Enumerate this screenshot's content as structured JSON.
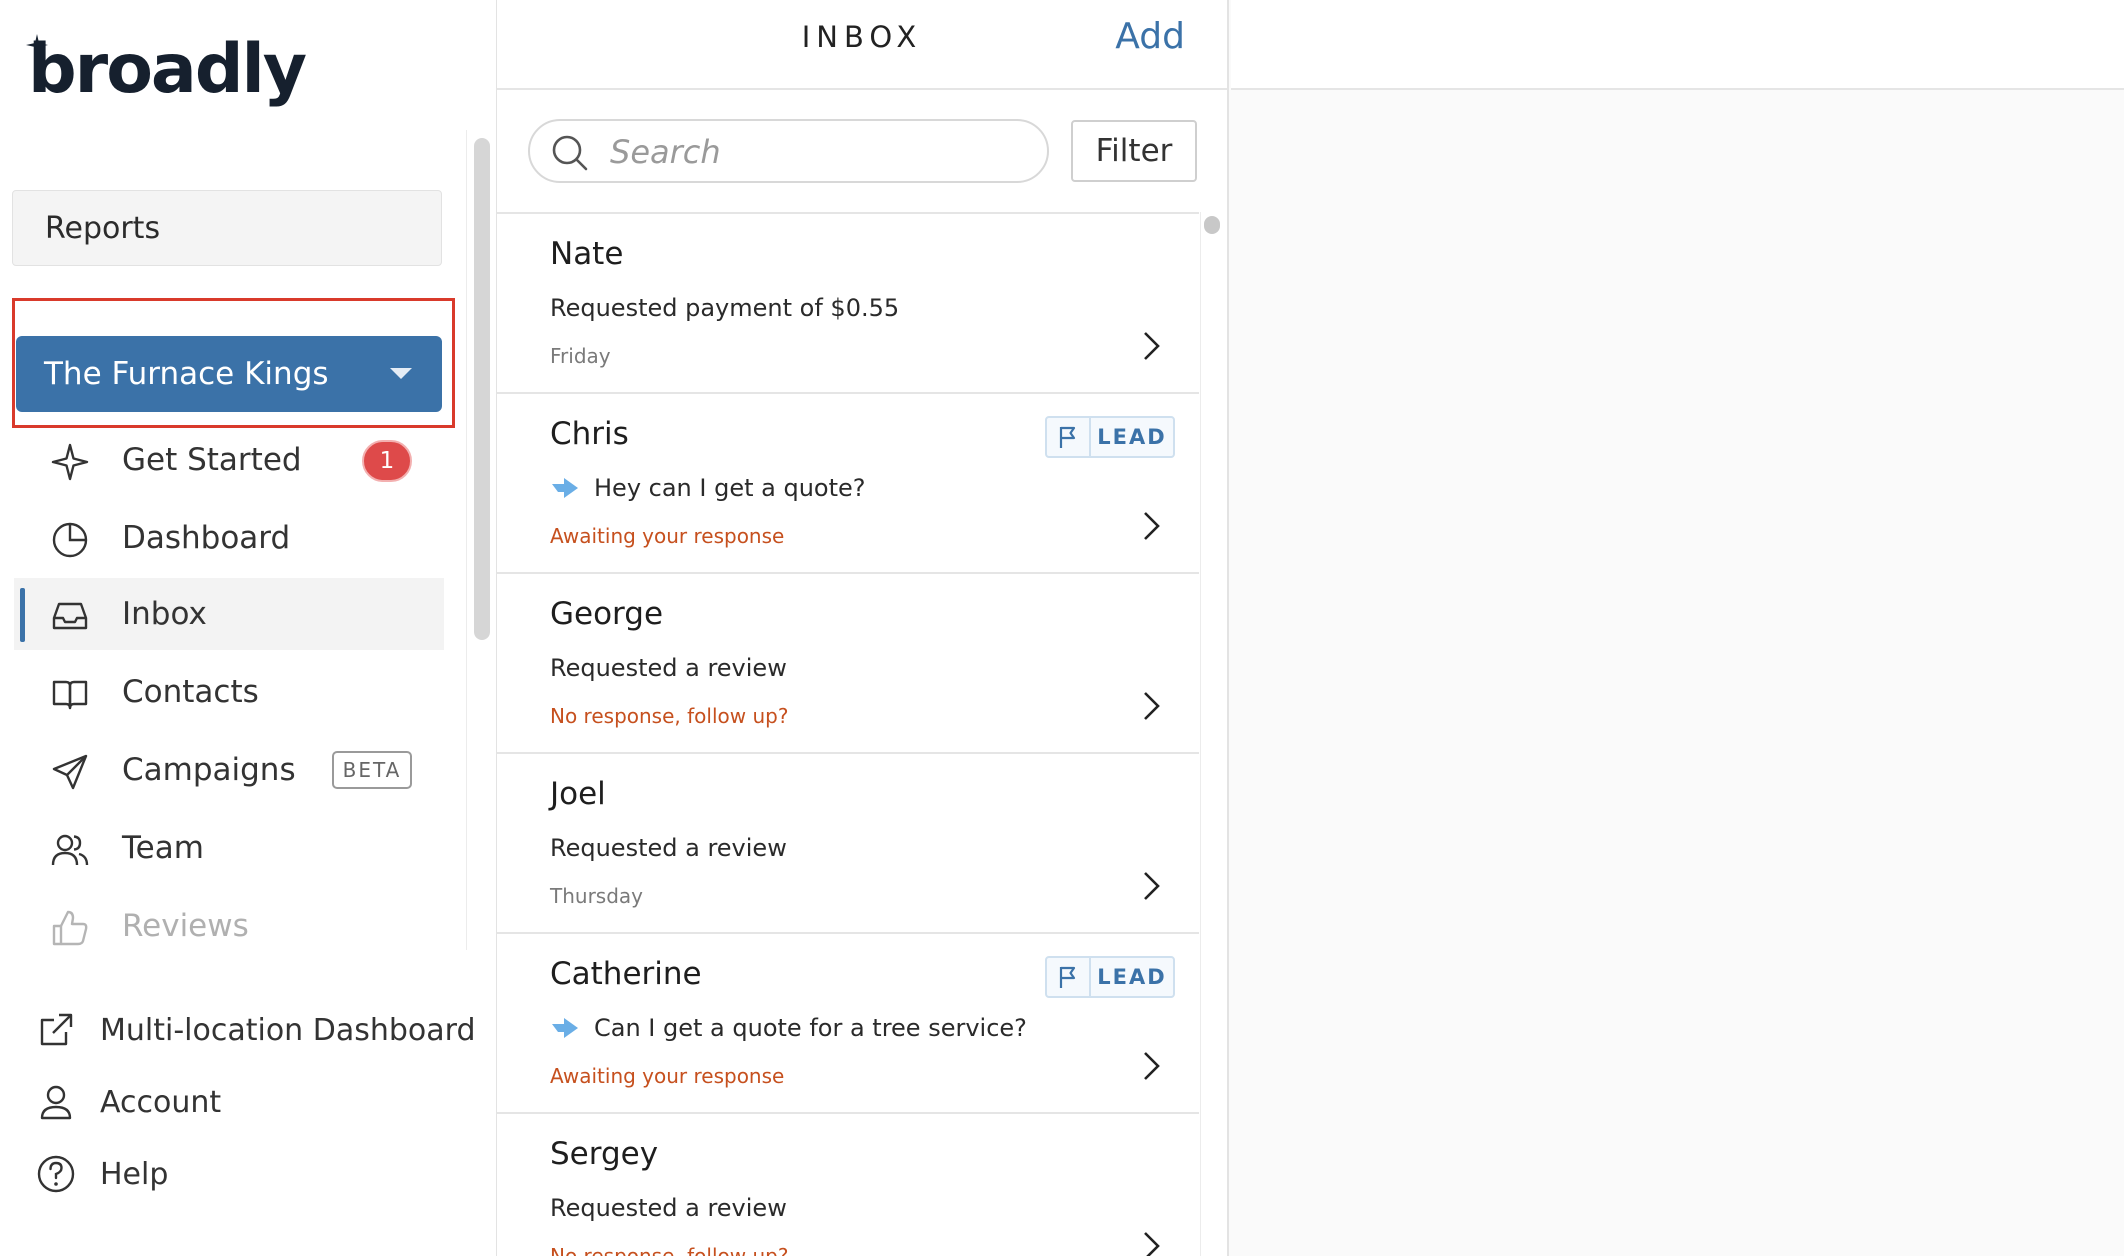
{
  "brand": {
    "logo_text": "broadly"
  },
  "sidebar": {
    "reports_label": "Reports",
    "location": {
      "name": "The Furnace Kings"
    },
    "nav": [
      {
        "label": "Get Started",
        "icon": "sparkle-icon",
        "badge": "1"
      },
      {
        "label": "Dashboard",
        "icon": "pie-chart-icon"
      },
      {
        "label": "Inbox",
        "icon": "inbox-tray-icon",
        "active": true
      },
      {
        "label": "Contacts",
        "icon": "book-icon"
      },
      {
        "label": "Campaigns",
        "icon": "paper-plane-icon",
        "tag": "BETA"
      },
      {
        "label": "Team",
        "icon": "people-icon"
      },
      {
        "label": "Reviews",
        "icon": "thumbs-up-icon",
        "faded": true
      }
    ],
    "footer": [
      {
        "label": "Multi-location Dashboard",
        "icon": "external-link-icon"
      },
      {
        "label": "Account",
        "icon": "user-icon"
      },
      {
        "label": "Help",
        "icon": "help-circle-icon"
      }
    ]
  },
  "inbox": {
    "title": "INBOX",
    "add_label": "Add",
    "search_placeholder": "Search",
    "filter_label": "Filter",
    "conversations": [
      {
        "name": "Nate",
        "message": "Requested payment of $0.55",
        "status": "Friday",
        "status_type": "date"
      },
      {
        "name": "Chris",
        "message": "Hey can I get a quote?",
        "status": "Awaiting your response",
        "status_type": "alert",
        "tag": "LEAD",
        "reply": true
      },
      {
        "name": "George",
        "message": "Requested a review",
        "status": "No response, follow up?",
        "status_type": "alert"
      },
      {
        "name": "Joel",
        "message": "Requested a review",
        "status": "Thursday",
        "status_type": "date"
      },
      {
        "name": "Catherine",
        "message": "Can I get a quote for a tree service?",
        "status": "Awaiting your response",
        "status_type": "alert",
        "tag": "LEAD",
        "reply": true
      },
      {
        "name": "Sergey",
        "message": "Requested a review",
        "status": "No response, follow up?",
        "status_type": "alert"
      }
    ]
  },
  "colors": {
    "brand_blue": "#3b72a8",
    "alert_orange": "#c6501e",
    "badge_red": "#de4a4a",
    "highlight_red": "#d93a2b"
  }
}
